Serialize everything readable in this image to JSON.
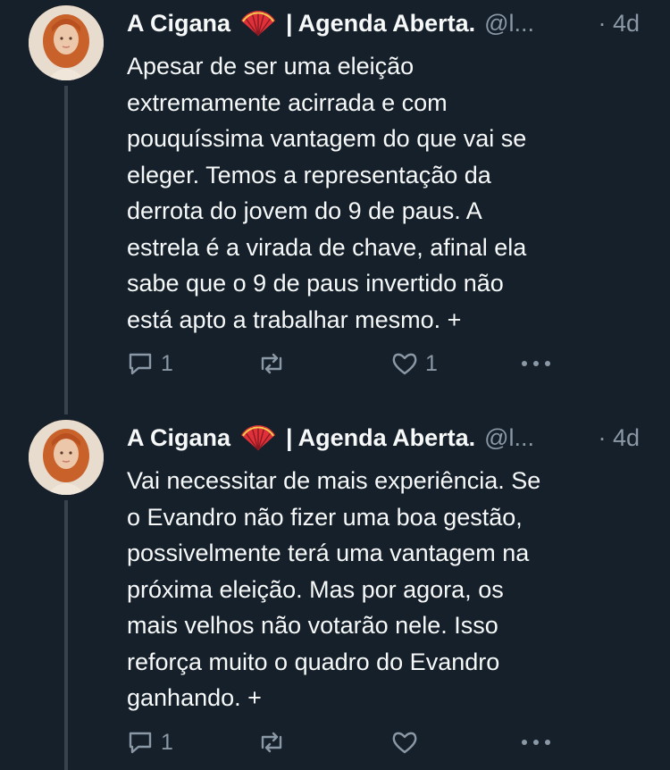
{
  "tweets": [
    {
      "name": "A Cigana",
      "org": "Agenda Aberta.",
      "handle": "@l...",
      "time": "· 4d",
      "text": "Apesar de ser uma eleição\nextremamente acirrada e com\npouquíssima vantagem do que vai se\neleger. Temos a representação da\nderrota do jovem do 9 de paus. A\nestrela é a virada de chave, afinal ela\nsabe que o 9 de paus invertido não\nestá apto a trabalhar mesmo. +",
      "reply_count": "1",
      "retweet_count": "",
      "like_count": "1"
    },
    {
      "name": "A Cigana",
      "org": "Agenda Aberta.",
      "handle": "@l...",
      "time": "· 4d",
      "text": "Vai necessitar de mais experiência. Se\no Evandro não fizer uma boa gestão,\npossivelmente terá uma vantagem na\npróxima eleição. Mas por agora, os\nmais velhos não votarão nele. Isso\nreforça muito o quadro do Evandro\nganhando. +",
      "reply_count": "1",
      "retweet_count": "",
      "like_count": ""
    }
  ],
  "icons": {
    "fan": "folding-fan-emoji",
    "reply": "reply-icon",
    "retweet": "retweet-icon",
    "like": "heart-icon",
    "more": "more-icon"
  },
  "colors": {
    "background": "#15202b",
    "text": "#f7f9f9",
    "muted": "#8b98a5",
    "thread_line": "#38444d"
  }
}
